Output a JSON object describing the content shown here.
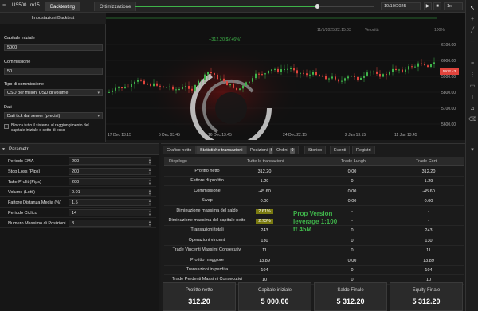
{
  "topbar": {
    "symbol": "US500",
    "timeframe": "m15",
    "tabs": [
      "Backtesting",
      "Ottimizzazione"
    ],
    "date_to": "10/10/2025",
    "speed_label": "1x"
  },
  "chart": {
    "tooltip": "+312.20 $ (+6%)",
    "date_from_label": "11/1/2025 22:15:03",
    "velocity_label": "Velocità",
    "velocity_value": "100%",
    "x_ticks": [
      "17 Dec 13:15",
      "5 Dec 03:45",
      "16 Dec 13:45",
      "24 Dec 22:15",
      "2 Jan 13:15",
      "11 Jan 13:45"
    ],
    "y_ticks": [
      "6100.00",
      "6000.00",
      "5900.00",
      "5800.00",
      "5700.00",
      "5600.00"
    ],
    "current_price": "5912.43",
    "colors": {
      "up": "#3fb34a",
      "down": "#e0443c",
      "bg": "#111111"
    },
    "logo": "swirl-logo"
  },
  "dialog": {
    "title": "Impostazioni Backtest",
    "capital_label": "Capitale Iniziale",
    "capital_value": "5000",
    "commission_label": "Commissione",
    "commission_value": "50",
    "commission_type_label": "Tipo di commissione",
    "commission_type_value": "USD per milioni USD di volume",
    "data_label": "Dati",
    "data_value": "Dati tick dai server (precisi)",
    "checkbox_label": "Blocca tutto il sistema al raggiungimento del capitale iniziale o sotto di esso"
  },
  "params": {
    "title": "Parametri",
    "rows": [
      {
        "label": "Periodo EMA",
        "value": "200"
      },
      {
        "label": "Stop Loss (Pips)",
        "value": "200"
      },
      {
        "label": "Take Profit (Pips)",
        "value": "200"
      },
      {
        "label": "Volume (Lotti)",
        "value": "0.01"
      },
      {
        "label": "Fattore Distanza Media (%)",
        "value": "1.5"
      },
      {
        "label": "Periodo Ciclico",
        "value": "14"
      },
      {
        "label": "Numero Massimo di Posizioni",
        "value": "3"
      }
    ]
  },
  "stats": {
    "tabs": [
      {
        "label": "Grafico netto",
        "badge": ""
      },
      {
        "label": "Statistiche transazioni",
        "badge": ""
      },
      {
        "label": "Posizioni",
        "badge": "0"
      },
      {
        "label": "Ordini",
        "badge": "0"
      },
      {
        "label": "Storico",
        "badge": ""
      },
      {
        "label": "Eventi",
        "badge": ""
      },
      {
        "label": "Registri",
        "badge": ""
      }
    ],
    "columns": [
      "Riepilogo",
      "Tutte le transazioni",
      "Trade Lunghi",
      "Trade Corti"
    ],
    "rows": [
      {
        "label": "Profitto netto",
        "all": "312.20",
        "long": "0.00",
        "short": "312.20",
        "hl": false
      },
      {
        "label": "Fattore di profitto",
        "all": "1.29",
        "long": "0",
        "short": "1.29",
        "hl": false
      },
      {
        "label": "Commissione",
        "all": "-45.60",
        "long": "0.00",
        "short": "-45.60",
        "hl": false
      },
      {
        "label": "Swap",
        "all": "0.00",
        "long": "0.00",
        "short": "0.00",
        "hl": false
      },
      {
        "label": "Diminuzione massima del saldo",
        "all": "2.61%",
        "long": "-",
        "short": "-",
        "hl": true
      },
      {
        "label": "Diminuzione massima del capitale netto",
        "all": "2.73%",
        "long": "-",
        "short": "-",
        "hl": true
      },
      {
        "label": "Transazioni totali",
        "all": "243",
        "long": "0",
        "short": "243",
        "hl": false
      },
      {
        "label": "Operazioni vincenti",
        "all": "130",
        "long": "0",
        "short": "130",
        "hl": false
      },
      {
        "label": "Trade Vincenti Massimi Consecutivi",
        "all": "11",
        "long": "0",
        "short": "11",
        "hl": false
      },
      {
        "label": "Profitto maggiore",
        "all": "13.89",
        "long": "0.00",
        "short": "13.89",
        "hl": false
      },
      {
        "label": "Transazioni in perdita",
        "all": "104",
        "long": "0",
        "short": "104",
        "hl": false
      },
      {
        "label": "Trade Perdenti Massimi Consecutivi",
        "all": "10",
        "long": "0",
        "short": "10",
        "hl": false
      }
    ],
    "watermark": [
      "Prop Version",
      "leverage 1:100",
      "tf 45M"
    ],
    "summary": [
      {
        "label": "Profitto netto",
        "value": "312.20"
      },
      {
        "label": "Capitale iniziale",
        "value": "5 000.00"
      },
      {
        "label": "Saldo Finale",
        "value": "5 312.20"
      },
      {
        "label": "Equity Finale",
        "value": "5 312.20"
      }
    ]
  }
}
